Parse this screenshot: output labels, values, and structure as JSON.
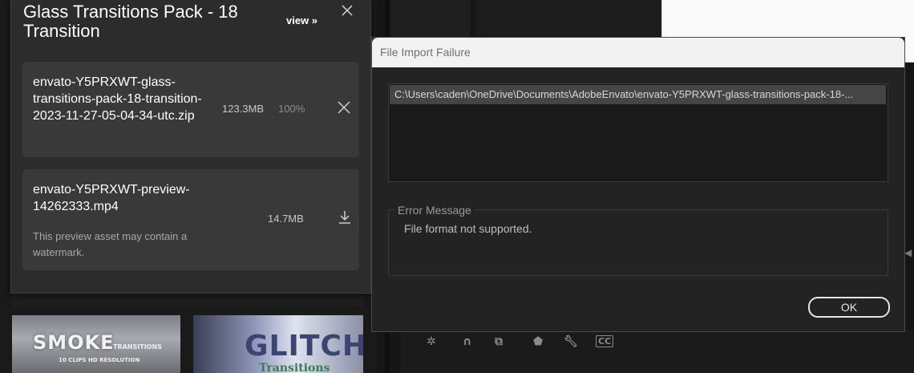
{
  "envato_panel": {
    "title": "Glass Transitions Pack - 18 Transition",
    "view_label": "view »",
    "items": [
      {
        "filename": "envato-Y5PRXWT-glass-transitions-pack-18-transition-2023-11-27-05-04-34-utc.zip",
        "size": "123.3MB",
        "progress": "100%",
        "action_icon": "close-icon"
      },
      {
        "filename": "envato-Y5PRXWT-preview-14262333.mp4",
        "size": "14.7MB",
        "note": "This preview asset may contain a watermark.",
        "action_icon": "download-icon"
      }
    ]
  },
  "thumbnails": [
    {
      "title": "SMOKE",
      "subtitle": "TRANSITIONS",
      "caption": "10 CLIPS HD RESOLUTION"
    },
    {
      "title": "GLITCH",
      "subtitle": "Transitions"
    }
  ],
  "dialog": {
    "title": "File Import Failure",
    "file_path": "C:\\Users\\caden\\OneDrive\\Documents\\AdobeEnvato\\envato-Y5PRXWT-glass-transitions-pack-18-...",
    "error_legend": "Error Message",
    "error_message": "File format not supported.",
    "ok_label": "OK"
  },
  "toolbar_icons": [
    "snap-icon",
    "magnet-icon",
    "linked-selection-icon",
    "marker-icon",
    "wrench-icon",
    "captions-icon"
  ],
  "toolbar_captions_label": "CC"
}
